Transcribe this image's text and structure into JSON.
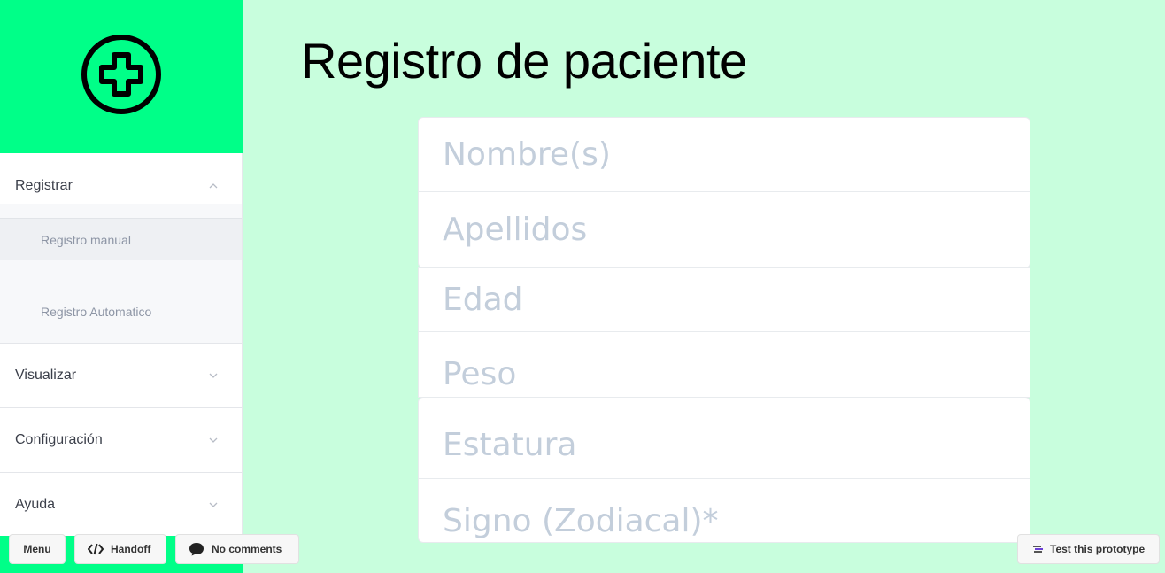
{
  "app": {
    "logo_icon": "plus-circle-icon",
    "brand_color": "#00ff88",
    "background_color": "#c8fedd"
  },
  "sidebar": {
    "sections": [
      {
        "label": "Registrar",
        "expanded": true,
        "icon": "chevron-up-icon"
      },
      {
        "label": "Visualizar",
        "expanded": false,
        "icon": "chevron-down-icon"
      },
      {
        "label": "Configuración",
        "expanded": false,
        "icon": "chevron-down-icon"
      },
      {
        "label": "Ayuda",
        "expanded": false,
        "icon": "chevron-down-icon"
      }
    ],
    "register_items": [
      {
        "label": "Registro manual",
        "active": true
      },
      {
        "label": "Registro Automatico",
        "active": false
      }
    ]
  },
  "main": {
    "title": "Registro de paciente",
    "fields": [
      {
        "placeholder": "Nombre(s)"
      },
      {
        "placeholder": "Apellidos"
      },
      {
        "placeholder": "Edad"
      },
      {
        "placeholder": "Peso"
      },
      {
        "placeholder": "Estatura"
      },
      {
        "placeholder": "Signo (Zodiacal)*"
      }
    ]
  },
  "toolbar": {
    "menu_label": "Menu",
    "handoff_label": "Handoff",
    "comments_label": "No comments",
    "test_label": "Test this prototype"
  }
}
